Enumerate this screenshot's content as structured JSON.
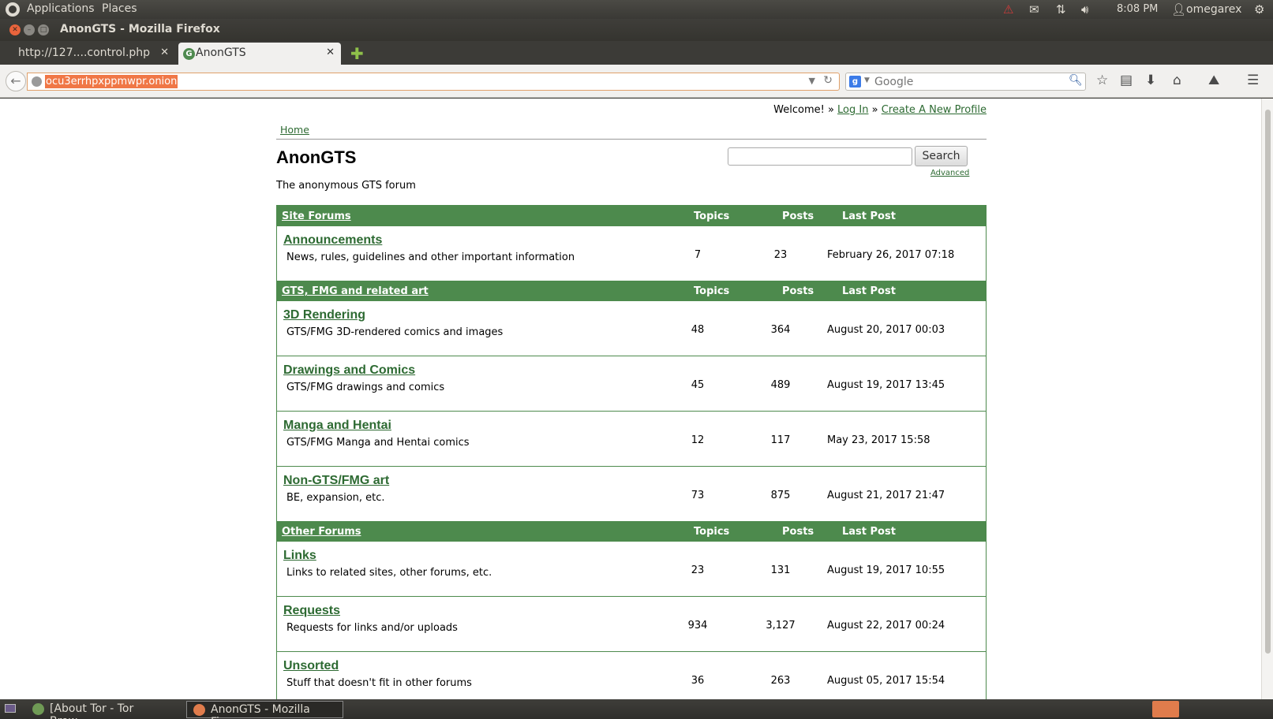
{
  "top_panel": {
    "applications": "Applications",
    "places": "Places",
    "clock": "8:08 PM",
    "user": "omegarex",
    "icons": [
      "warning-icon",
      "mail-icon",
      "network-icon",
      "volume-icon",
      "user-icon",
      "gear-icon"
    ]
  },
  "window": {
    "title": "AnonGTS - Mozilla Firefox"
  },
  "tabs": [
    {
      "label": "http://127....control.php"
    },
    {
      "label": "AnonGTS"
    }
  ],
  "toolbar": {
    "url": "ocu3errhpxppmwpr.onion",
    "search_placeholder": "Google"
  },
  "page": {
    "welcome_prefix": "Welcome! »",
    "login": "Log In",
    "separator": "»",
    "create_profile": "Create A New Profile",
    "breadcrumb_home": "Home",
    "title": "AnonGTS",
    "description": "The anonymous GTS forum",
    "search_button": "Search",
    "advanced": "Advanced",
    "col_topics": "Topics",
    "col_posts": "Posts",
    "col_last": "Last Post"
  },
  "sections": [
    {
      "name": "Site Forums",
      "forums": [
        {
          "name": "Announcements",
          "desc": "News, rules, guidelines and other important information",
          "topics": "7",
          "posts": "23",
          "last": "February 26, 2017 07:18"
        }
      ]
    },
    {
      "name": "GTS, FMG and related art",
      "forums": [
        {
          "name": "3D Rendering",
          "desc": "GTS/FMG 3D-rendered comics and images",
          "topics": "48",
          "posts": "364",
          "last": "August 20, 2017 00:03"
        },
        {
          "name": "Drawings and Comics",
          "desc": "GTS/FMG drawings and comics",
          "topics": "45",
          "posts": "489",
          "last": "August 19, 2017 13:45"
        },
        {
          "name": "Manga and Hentai",
          "desc": "GTS/FMG Manga and Hentai comics",
          "topics": "12",
          "posts": "117",
          "last": "May 23, 2017 15:58"
        },
        {
          "name": "Non-GTS/FMG art",
          "desc": "BE, expansion, etc.",
          "topics": "73",
          "posts": "875",
          "last": "August 21, 2017 21:47"
        }
      ]
    },
    {
      "name": "Other Forums",
      "forums": [
        {
          "name": "Links",
          "desc": "Links to related sites, other forums, etc.",
          "topics": "23",
          "posts": "131",
          "last": "August 19, 2017 10:55"
        },
        {
          "name": "Requests",
          "desc": "Requests for links and/or uploads",
          "topics": "934",
          "posts": "3,127",
          "last": "August 22, 2017 00:24"
        },
        {
          "name": "Unsorted",
          "desc": "Stuff that doesn't fit in other forums",
          "topics": "36",
          "posts": "263",
          "last": "August 05, 2017 15:54"
        }
      ]
    }
  ],
  "taskbar": {
    "items": [
      {
        "label": "[About Tor - Tor Brow..."
      },
      {
        "label": "AnonGTS - Mozilla Fir..."
      }
    ]
  }
}
